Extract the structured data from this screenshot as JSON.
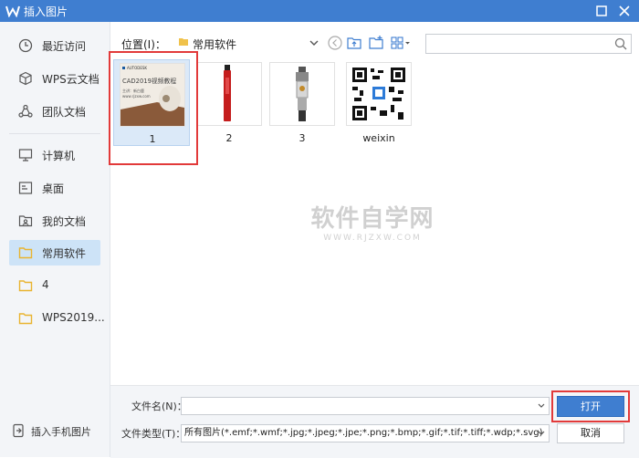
{
  "window": {
    "title": "插入图片"
  },
  "sidebar": {
    "items": [
      {
        "label": "最近访问",
        "icon": "clock-icon"
      },
      {
        "label": "WPS云文档",
        "icon": "cube-icon"
      },
      {
        "label": "团队文档",
        "icon": "team-icon"
      },
      {
        "label": "计算机",
        "icon": "computer-icon"
      },
      {
        "label": "桌面",
        "icon": "desktop-icon"
      },
      {
        "label": "我的文档",
        "icon": "my-docs-icon"
      },
      {
        "label": "常用软件",
        "icon": "folder-icon",
        "active": true
      },
      {
        "label": "4",
        "icon": "folder-icon"
      },
      {
        "label": "WPS2019...",
        "icon": "folder-icon"
      }
    ],
    "phone_images_label": "插入手机图片"
  },
  "location": {
    "label": "位置(I)：",
    "current": "常用软件"
  },
  "files": [
    {
      "name": "1",
      "selected": true,
      "thumb_title": "CAD2019视频教程",
      "thumb_brand": "AUTODESK",
      "thumb_sub": "主讲：新白鹿",
      "thumb_url": "www.rjzxw.com"
    },
    {
      "name": "2"
    },
    {
      "name": "3"
    },
    {
      "name": "weixin"
    }
  ],
  "watermark": {
    "main": "软件自学网",
    "sub": "WWW.RJZXW.COM"
  },
  "filename": {
    "label": "文件名(N)：",
    "value": ""
  },
  "filetype": {
    "label": "文件类型(T)：",
    "value": "所有图片(*.emf;*.wmf;*.jpg;*.jpeg;*.jpe;*.png;*.bmp;*.gif;*.tif;*.tiff;*.wdp;*.svg)"
  },
  "buttons": {
    "open": "打开",
    "cancel": "取消"
  },
  "colors": {
    "accent": "#3f7ed0",
    "highlight": "#e23a3a",
    "folder": "#f0c24b"
  }
}
